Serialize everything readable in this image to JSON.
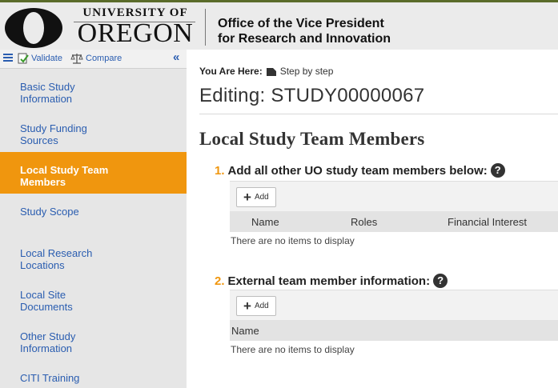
{
  "header": {
    "uni_top": "UNIVERSITY OF",
    "uni_bottom": "OREGON",
    "office_line1": "Office of the Vice President",
    "office_line2": "for Research and Innovation"
  },
  "toolbar": {
    "validate": "Validate",
    "compare": "Compare"
  },
  "sidebar": {
    "items": [
      {
        "line1": "Basic Study",
        "line2": "Information"
      },
      {
        "line1": "Study Funding",
        "line2": "Sources"
      },
      {
        "line1": "Local Study Team",
        "line2": "Members"
      },
      {
        "line1": "Study Scope",
        "line2": ""
      },
      {
        "line1": "Local Research",
        "line2": "Locations"
      },
      {
        "line1": "Local Site",
        "line2": "Documents"
      },
      {
        "line1": "Other Study",
        "line2": "Information"
      },
      {
        "line1": "CITI Training",
        "line2": ""
      }
    ],
    "active_index": 2
  },
  "main": {
    "here_label": "You Are Here:",
    "crumb": "Step by step",
    "editing": "Editing: STUDY00000067",
    "section_title": "Local Study Team Members",
    "q1_num": "1.",
    "q1_text": "Add all other UO study team members below:",
    "q2_num": "2.",
    "q2_text": "External team member information:",
    "add_label": "Add",
    "grid1_columns": [
      "Name",
      "Roles",
      "Financial Interest"
    ],
    "grid2_columns": [
      "Name"
    ],
    "empty_text": "There are no items to display"
  },
  "colors": {
    "accent": "#f0960e",
    "link": "#2a5db0",
    "header_bg": "#ebebeb",
    "sidebar_bg": "#e6e6e6"
  }
}
